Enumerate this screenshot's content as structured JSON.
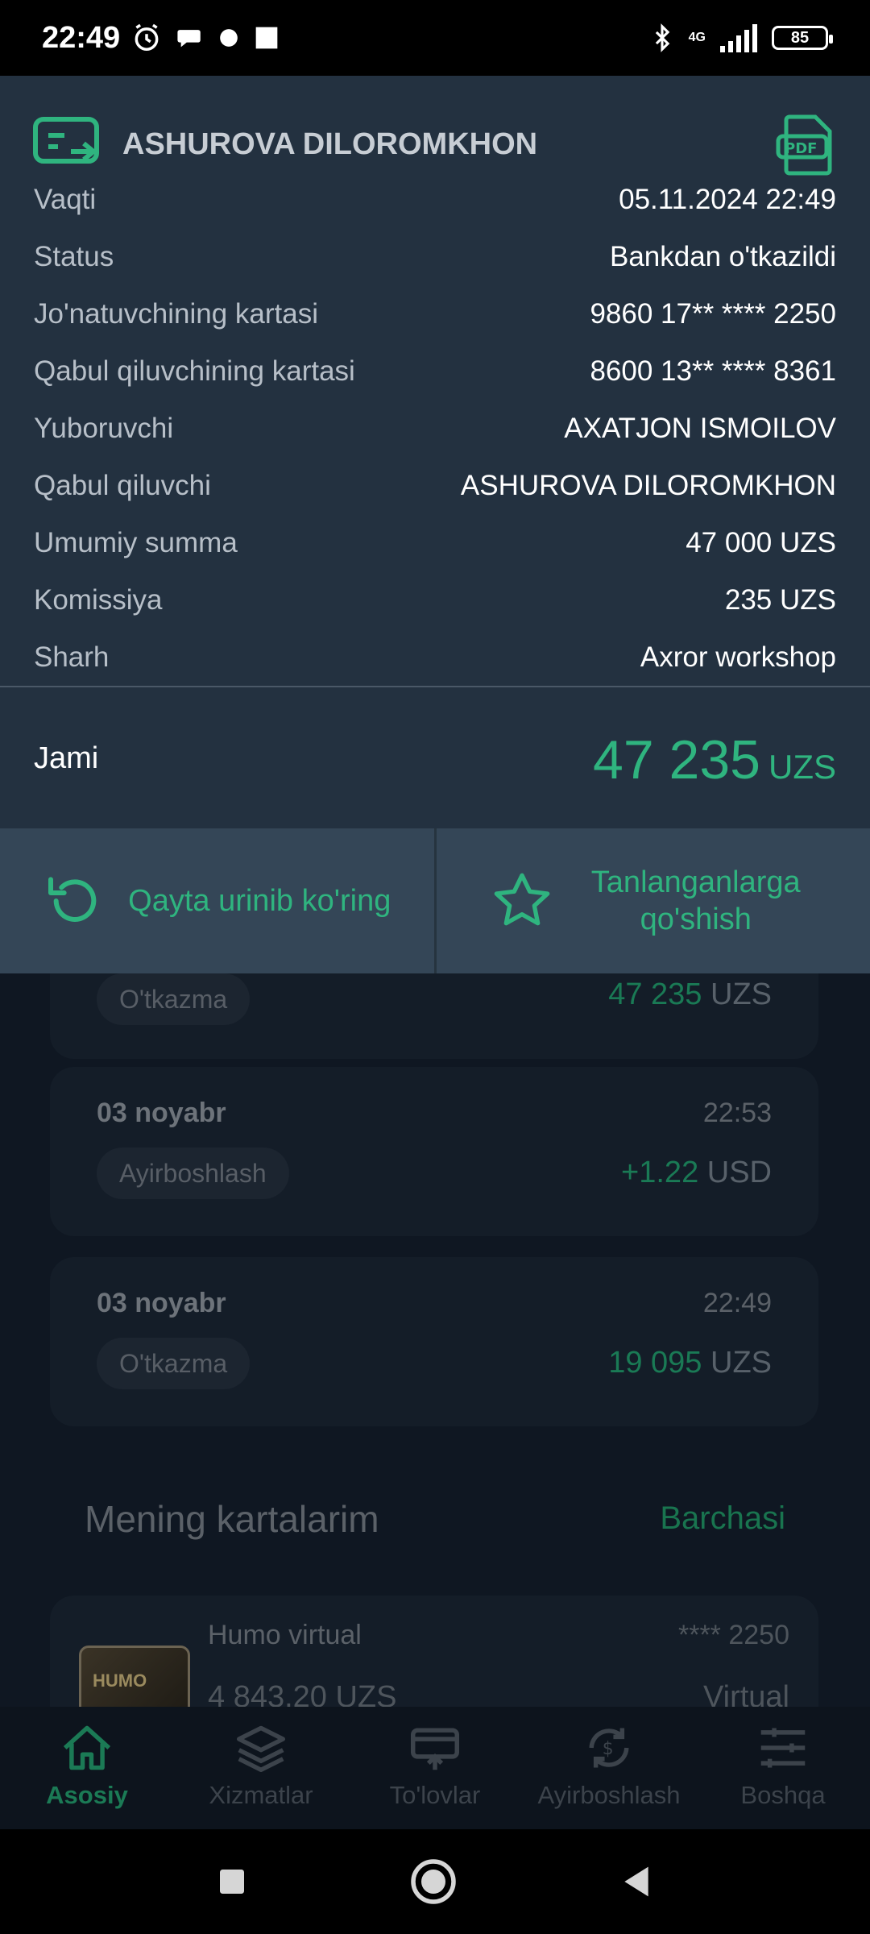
{
  "status_bar": {
    "time": "22:49",
    "network": "4G",
    "battery": "85"
  },
  "receipt": {
    "recipient_title": "ASHUROVA DILOROMKHON",
    "rows": [
      {
        "label": "Vaqti",
        "value": "05.11.2024 22:49"
      },
      {
        "label": "Status",
        "value": "Bankdan o'tkazildi"
      },
      {
        "label": "Jo'natuvchining kartasi",
        "value": "9860 17** **** 2250"
      },
      {
        "label": "Qabul qiluvchining kartasi",
        "value": "8600 13** **** 8361"
      },
      {
        "label": "Yuboruvchi",
        "value": "AXATJON ISMOILOV"
      },
      {
        "label": "Qabul qiluvchi",
        "value": "ASHUROVA DILOROMKHON"
      },
      {
        "label": "Umumiy summa",
        "value": "47 000 UZS"
      },
      {
        "label": "Komissiya",
        "value": "235 UZS"
      },
      {
        "label": "Sharh",
        "value": "Axror workshop"
      }
    ],
    "total_label": "Jami",
    "total_amount": "47 235",
    "total_currency": "UZS",
    "retry_label": "Qayta urinib ko'ring",
    "favorite_label": "Tanlanganlarga qo'shish"
  },
  "history": [
    {
      "chip": "O'tkazma",
      "amount": "47 235",
      "currency": "UZS"
    },
    {
      "date": "03 noyabr",
      "time": "22:53",
      "chip": "Ayirboshlash",
      "amount": "+1.22",
      "currency": "USD"
    },
    {
      "date": "03 noyabr",
      "time": "22:49",
      "chip": "O'tkazma",
      "amount": "19 095",
      "currency": "UZS"
    }
  ],
  "cards_section": {
    "title": "Mening kartalarim",
    "link": "Barchasi",
    "card": {
      "name": "Humo virtual",
      "brand": "HUMO",
      "number": "**** 2250",
      "balance": "4 843.20 UZS",
      "type": "Virtual"
    }
  },
  "bottom_nav": [
    {
      "label": "Asosiy",
      "icon": "home-icon",
      "active": true
    },
    {
      "label": "Xizmatlar",
      "icon": "layers-icon"
    },
    {
      "label": "To'lovlar",
      "icon": "payment-icon"
    },
    {
      "label": "Ayirboshlash",
      "icon": "exchange-icon"
    },
    {
      "label": "Boshqa",
      "icon": "menu-icon"
    }
  ],
  "colors": {
    "accent": "#2fb47f",
    "sheet_bg": "#233140",
    "button_bg": "#344657"
  }
}
